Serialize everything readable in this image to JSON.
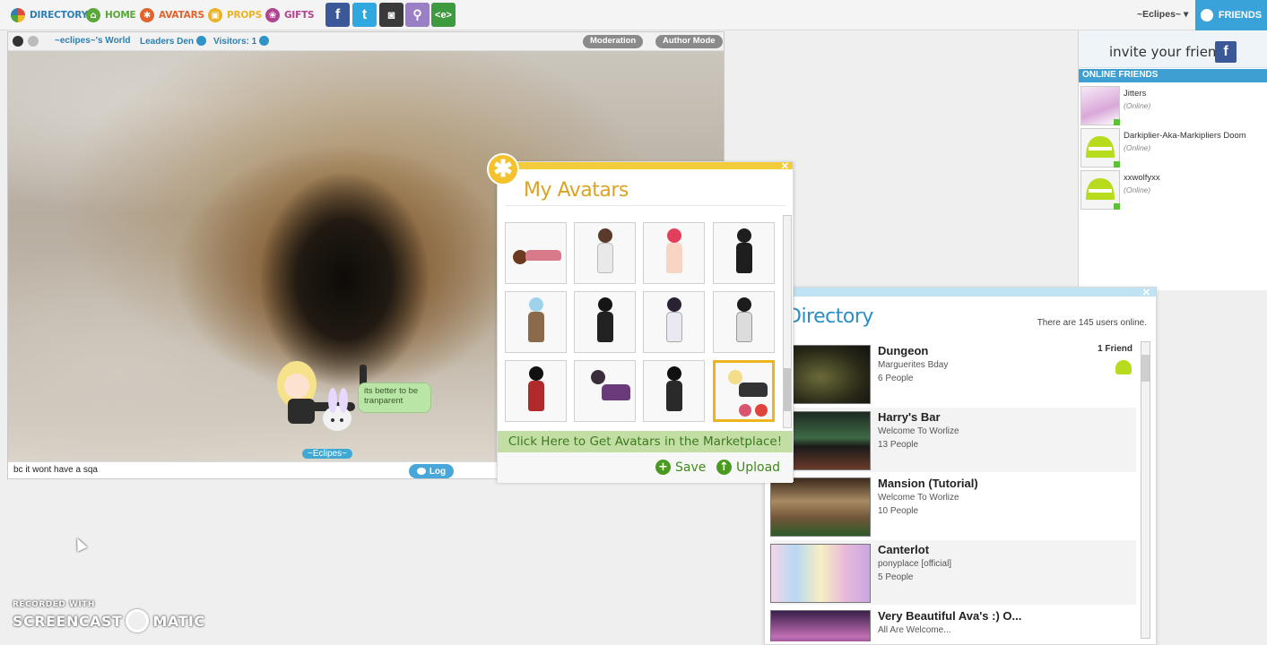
{
  "nav": {
    "items": [
      {
        "label": "DIRECTORY",
        "color": "#2f7fb5",
        "icon": "globe-icon"
      },
      {
        "label": "HOME",
        "color": "#5aa73a",
        "icon": "home-icon"
      },
      {
        "label": "AVATARS",
        "color": "#e2632c",
        "icon": "avatars-icon"
      },
      {
        "label": "PROPS",
        "color": "#e9b327",
        "icon": "props-icon"
      },
      {
        "label": "GIFTS",
        "color": "#b0458f",
        "icon": "gifts-icon"
      }
    ],
    "social": [
      {
        "label": "f",
        "name": "facebook-icon"
      },
      {
        "label": "t",
        "name": "twitter-icon"
      },
      {
        "label": "◙",
        "name": "camera-icon"
      },
      {
        "label": "⚲",
        "name": "link-icon"
      },
      {
        "label": "<e>",
        "name": "embed-icon"
      }
    ],
    "user_menu": "~Eclipes~ ▾",
    "friends_tab": "FRIENDS"
  },
  "world": {
    "name": "~eclipes~'s World",
    "leaders": "Leaders Den",
    "visitors": "Visitors: 1",
    "moderation": "Moderation",
    "author_mode": "Author Mode",
    "bubble_text": "its better to be tranparent",
    "nametag": "~Eclipes~",
    "chat_value": "bc it wont have a sqa",
    "log_label": "Log"
  },
  "friends_panel": {
    "invite_text": "invite your friends:",
    "invite_fb": "f",
    "online_header": "ONLINE FRIENDS",
    "friends": [
      {
        "name": "Jitters",
        "status": "(Online)"
      },
      {
        "name": "Darkiplier-Aka-Markipliers Doom",
        "status": "(Online)"
      },
      {
        "name": "xxwolfyxx",
        "status": "(Online)"
      }
    ]
  },
  "my_avatars": {
    "title": "My Avatars",
    "badge": "✱",
    "close": "✕",
    "market_text": "Click Here to Get Avatars in the Marketplace!",
    "save_label": "Save",
    "upload_label": "Upload"
  },
  "directory": {
    "title": "Directory",
    "users_online": "There are 145 users online.",
    "close": "✕",
    "rooms": [
      {
        "name": "Dungeon",
        "desc": "Marguerites Bday",
        "people": "6 People",
        "friends": "1 Friend"
      },
      {
        "name": "Harry's Bar",
        "desc": "Welcome To Worlize",
        "people": "13 People",
        "friends": ""
      },
      {
        "name": "Mansion (Tutorial)",
        "desc": "Welcome To Worlize",
        "people": "10 People",
        "friends": ""
      },
      {
        "name": "Canterlot",
        "desc": "ponyplace [official]",
        "people": "5 People",
        "friends": ""
      },
      {
        "name": "Very Beautiful Ava's :) O...",
        "desc": "All Are Welcome...",
        "people": "",
        "friends": ""
      }
    ]
  },
  "watermark": {
    "line1": "RECORDED WITH",
    "line2a": "SCREENCAST",
    "line2b": "MATIC"
  }
}
